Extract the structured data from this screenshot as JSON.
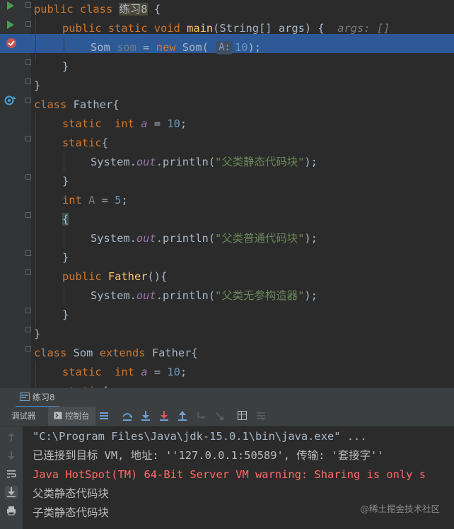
{
  "editor": {
    "lines": [
      {
        "parts": [
          [
            "kw",
            "public "
          ],
          [
            "kw",
            "class "
          ],
          [
            "hl",
            "练习8"
          ],
          [
            "bw",
            " {"
          ]
        ]
      },
      {
        "parts": [
          [
            "kw",
            "public "
          ],
          [
            "kw",
            "static "
          ],
          [
            "kw",
            "void "
          ],
          [
            "fn",
            "main"
          ],
          [
            "bw",
            "(String[] args) {  "
          ],
          [
            "inlay",
            "args: []"
          ]
        ]
      },
      {
        "parts": [
          [
            "bw",
            "Som "
          ],
          [
            "dimv",
            "som"
          ],
          [
            "bw",
            " = "
          ],
          [
            "kw",
            "new "
          ],
          [
            "bw",
            "Som( "
          ],
          [
            "hint",
            "A:"
          ],
          [
            "num",
            "10"
          ],
          [
            "bw",
            ");"
          ]
        ]
      },
      {
        "parts": [
          [
            "bw",
            "}"
          ]
        ]
      },
      {
        "parts": [
          [
            "bw",
            "}"
          ]
        ]
      },
      {
        "parts": [
          [
            "kw",
            "class "
          ],
          [
            "bw",
            "Father{"
          ]
        ]
      },
      {
        "parts": [
          [
            "kw",
            "static  "
          ],
          [
            "kw",
            "int "
          ],
          [
            "fld",
            "a"
          ],
          [
            "bw",
            " = "
          ],
          [
            "num",
            "10"
          ],
          [
            "bw",
            ";"
          ]
        ]
      },
      {
        "parts": [
          [
            "kw",
            "static"
          ],
          [
            "bw",
            "{"
          ]
        ]
      },
      {
        "parts": [
          [
            "bw",
            "System."
          ],
          [
            "fld",
            "out"
          ],
          [
            "bw",
            ".println("
          ],
          [
            "str",
            "\"父类静态代码块\""
          ],
          [
            "bw",
            ");"
          ]
        ]
      },
      {
        "parts": [
          [
            "bw",
            "}"
          ]
        ]
      },
      {
        "parts": [
          [
            "kw",
            "int "
          ],
          [
            "grey",
            "A"
          ],
          [
            "bw",
            " = "
          ],
          [
            "num",
            "5"
          ],
          [
            "bw",
            ";"
          ]
        ]
      },
      {
        "parts": [
          [
            "brace",
            "{"
          ]
        ]
      },
      {
        "parts": [
          [
            "bw",
            "System."
          ],
          [
            "fld",
            "out"
          ],
          [
            "bw",
            ".println("
          ],
          [
            "str",
            "\"父类普通代码块\""
          ],
          [
            "bw",
            ");"
          ]
        ]
      },
      {
        "parts": [
          [
            "bw",
            "}"
          ]
        ]
      },
      {
        "parts": [
          [
            "kw",
            "public "
          ],
          [
            "fn",
            "Father"
          ],
          [
            "bw",
            "(){"
          ]
        ]
      },
      {
        "parts": [
          [
            "bw",
            "System."
          ],
          [
            "fld",
            "out"
          ],
          [
            "bw",
            ".println("
          ],
          [
            "str",
            "\"父类无参构造器\""
          ],
          [
            "bw",
            ");"
          ]
        ]
      },
      {
        "parts": [
          [
            "bw",
            "}"
          ]
        ]
      },
      {
        "parts": [
          [
            "bw",
            "}"
          ]
        ]
      },
      {
        "parts": [
          [
            "kw",
            "class "
          ],
          [
            "bw",
            "Som "
          ],
          [
            "kw",
            "extends "
          ],
          [
            "bw",
            "Father{"
          ]
        ]
      },
      {
        "parts": [
          [
            "kw",
            "static  "
          ],
          [
            "kw",
            "int "
          ],
          [
            "fld",
            "a"
          ],
          [
            "bw",
            " = "
          ],
          [
            "num",
            "10"
          ],
          [
            "bw",
            ";"
          ]
        ]
      },
      {
        "parts": [
          [
            "kw",
            "static"
          ],
          [
            "bw",
            "{"
          ]
        ]
      }
    ]
  },
  "tool_window": {
    "tab_label": "练习8",
    "tabs": [
      {
        "label": "调试器"
      },
      {
        "label": "控制台"
      }
    ]
  },
  "console": {
    "lines": [
      {
        "kind": "con-cmd",
        "text": "\"C:\\Program Files\\Java\\jdk-15.0.1\\bin\\java.exe\" ..."
      },
      {
        "kind": "con-info",
        "text": "已连接到目标 VM, 地址: ''127.0.0.1:50589', 传输: '套接字''"
      },
      {
        "kind": "con-err",
        "text": "Java HotSpot(TM) 64-Bit Server VM warning: Sharing is only s"
      },
      {
        "kind": "con-out",
        "text": "父类静态代码块"
      },
      {
        "kind": "con-out",
        "text": "子类静态代码块"
      }
    ]
  },
  "watermark": "@稀土掘金技术社区",
  "colors": {
    "editor_bg": "#2b2b2b",
    "exec_line": "#2d5a96",
    "keyword": "#cc7832",
    "string": "#6a8759",
    "number": "#6897bb",
    "error": "#ff6b68",
    "run_green": "#499c54",
    "breakpoint_red": "#c75450"
  }
}
